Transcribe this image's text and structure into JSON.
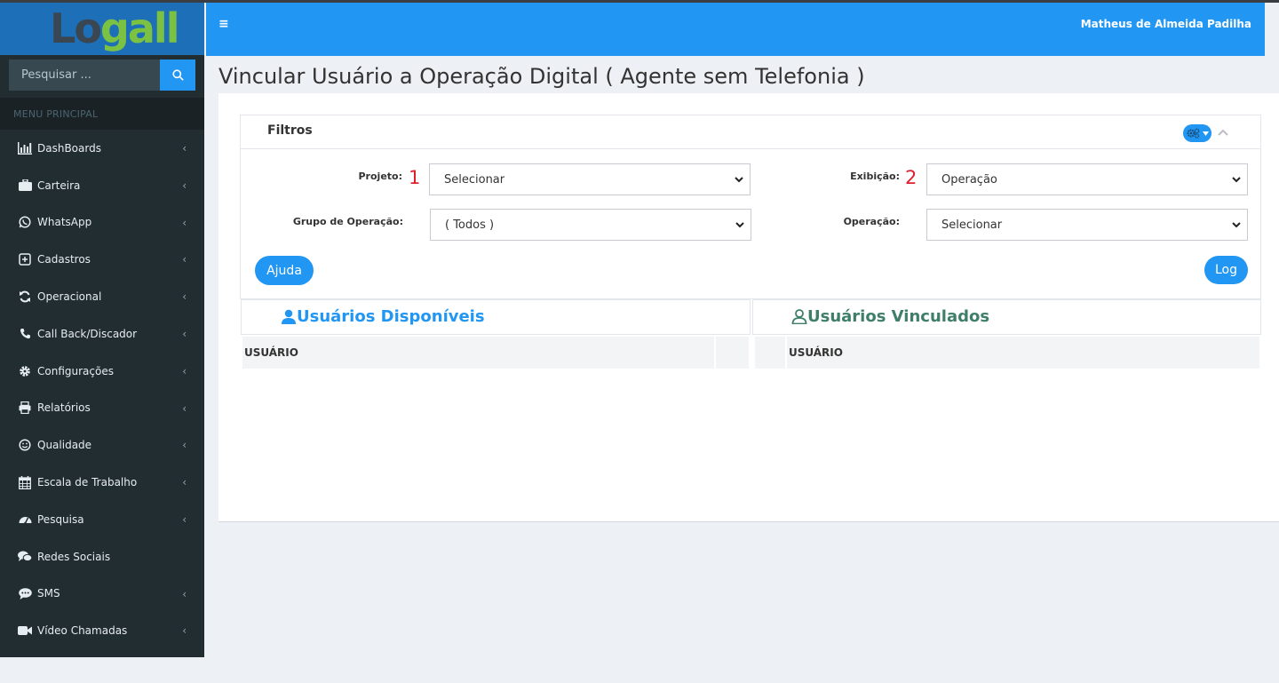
{
  "app": {
    "logo_text": "Logall"
  },
  "search": {
    "placeholder": "Pesquisar ..."
  },
  "sidebar": {
    "header": "MENU PRINCIPAL",
    "items": [
      {
        "label": "DashBoards",
        "icon": "bar-chart-icon",
        "has_chevron": true
      },
      {
        "label": "Carteira",
        "icon": "briefcase-icon",
        "has_chevron": true
      },
      {
        "label": "WhatsApp",
        "icon": "whatsapp-icon",
        "has_chevron": true
      },
      {
        "label": "Cadastros",
        "icon": "plus-square-icon",
        "has_chevron": true
      },
      {
        "label": "Operacional",
        "icon": "refresh-icon",
        "has_chevron": true
      },
      {
        "label": "Call Back/Discador",
        "icon": "phone-icon",
        "has_chevron": true
      },
      {
        "label": "Configurações",
        "icon": "gear-icon",
        "has_chevron": true
      },
      {
        "label": "Relatórios",
        "icon": "printer-icon",
        "has_chevron": true
      },
      {
        "label": "Qualidade",
        "icon": "smile-icon",
        "has_chevron": true
      },
      {
        "label": "Escala de Trabalho",
        "icon": "calendar-icon",
        "has_chevron": true
      },
      {
        "label": "Pesquisa",
        "icon": "dashboard-gauge-icon",
        "has_chevron": true
      },
      {
        "label": "Redes Sociais",
        "icon": "comments-icon",
        "has_chevron": false
      },
      {
        "label": "SMS",
        "icon": "sms-chat-icon",
        "has_chevron": true
      },
      {
        "label": "Vídeo Chamadas",
        "icon": "video-camera-icon",
        "has_chevron": true
      }
    ]
  },
  "header": {
    "user_name": "Matheus de Almeida Padilha"
  },
  "page": {
    "title": "Vincular Usuário a Operação Digital ( Agente sem Telefonia )"
  },
  "filters": {
    "title": "Filtros",
    "projeto_label": "Projeto:",
    "projeto_value": "Selecionar",
    "projeto_marker": "1",
    "exibicao_label": "Exibição:",
    "exibicao_value": "Operação",
    "exibicao_marker": "2",
    "grupo_label": "Grupo de Operação:",
    "grupo_value": "( Todos )",
    "operacao_label": "Operação:",
    "operacao_value": "Selecionar",
    "help_button": "Ajuda",
    "log_button": "Log"
  },
  "available": {
    "title": "Usuários Disponíveis",
    "column": "USUÁRIO"
  },
  "linked": {
    "title": "Usuários Vinculados",
    "column": "USUÁRIO"
  },
  "colors": {
    "accent": "#2196f3",
    "sidebar_bg": "#222d32",
    "available_title": "#2196f3",
    "linked_title": "#3f7f6a",
    "marker": "#e01e2e"
  }
}
